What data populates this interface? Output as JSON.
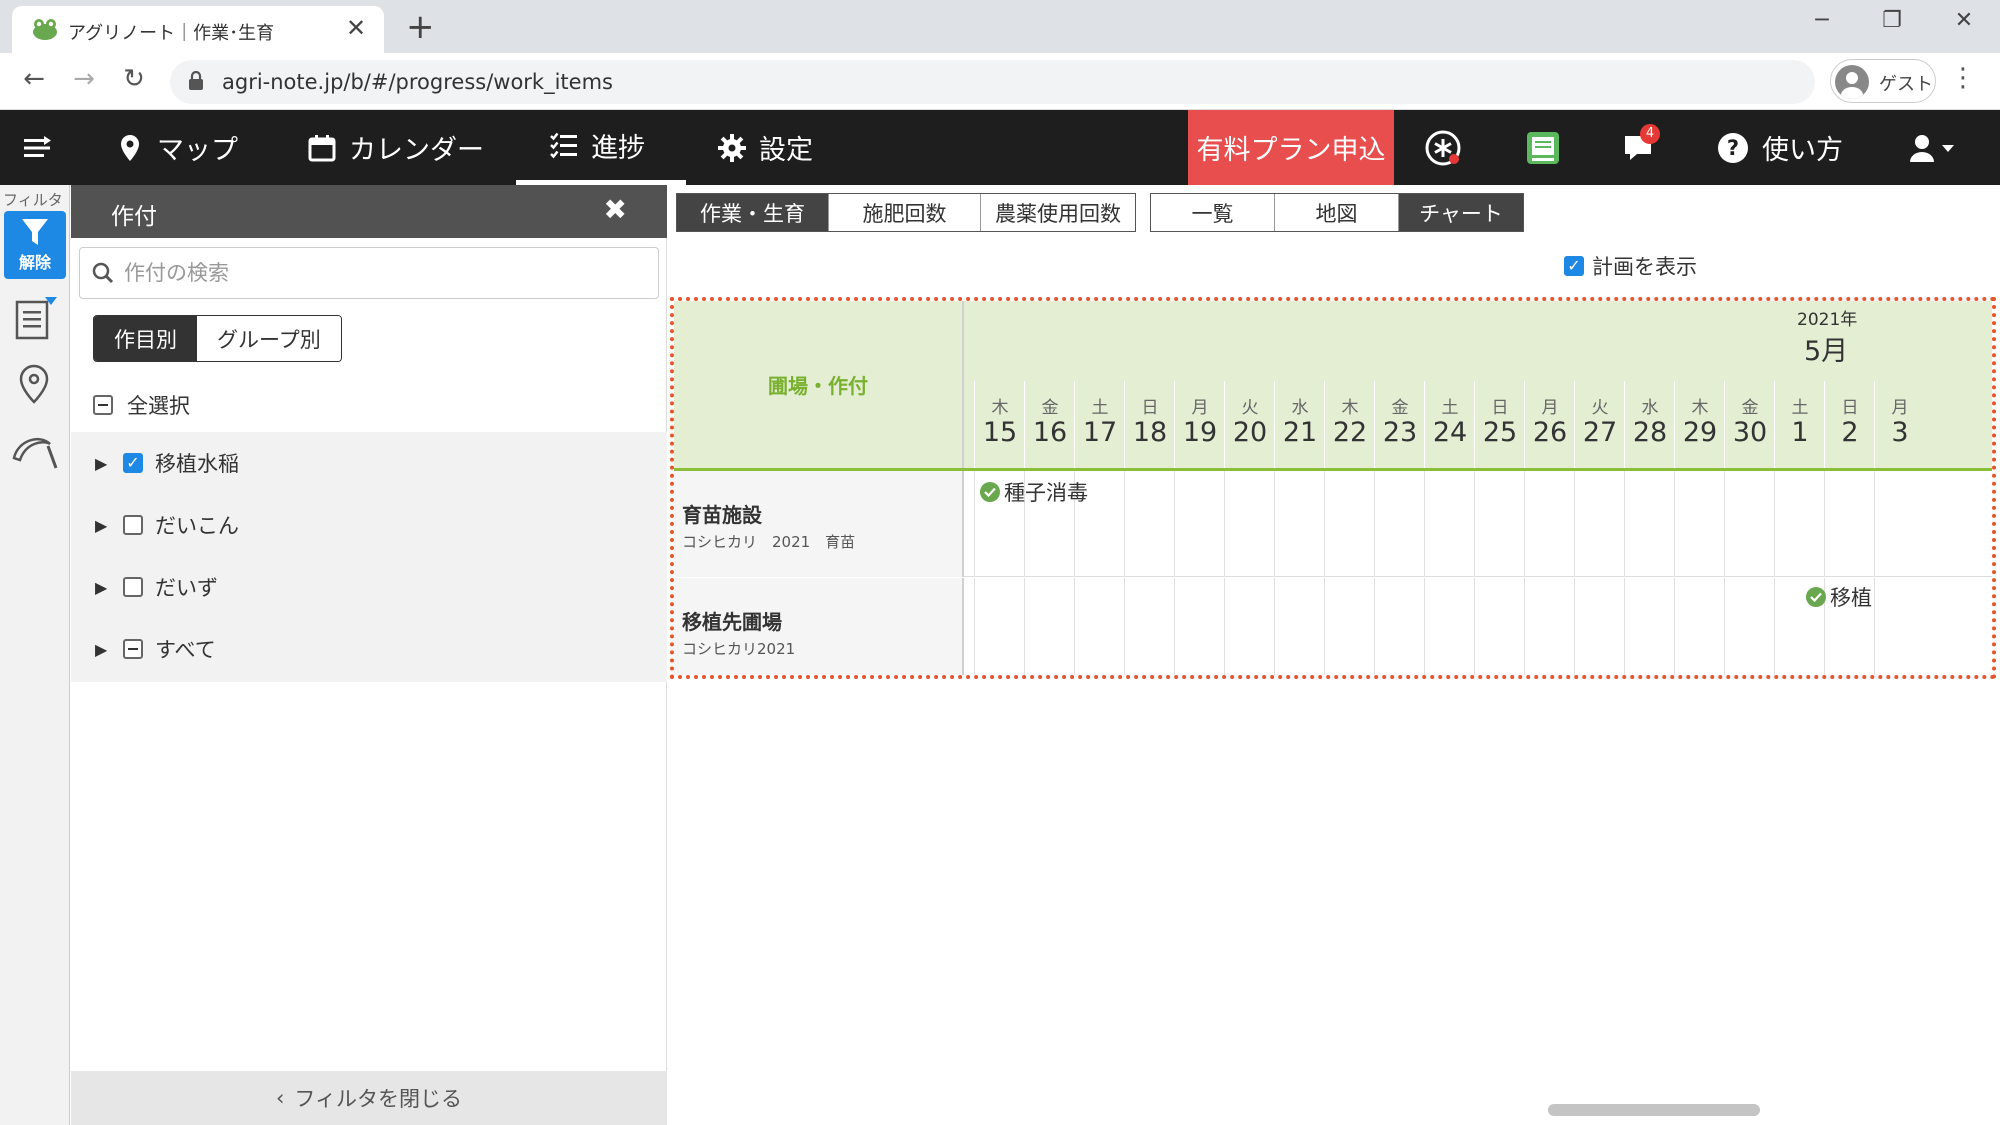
{
  "browser": {
    "tab_title": "アグリノート｜作業･生育",
    "url": "agri-note.jp/b/#/progress/work_items",
    "profile_label": "ゲスト"
  },
  "nav": {
    "map": "マップ",
    "calendar": "カレンダー",
    "progress": "進捗",
    "settings": "設定",
    "plan_button": "有料プラン申込",
    "notification_count": "4",
    "help": "使い方"
  },
  "rail": {
    "filter_label": "フィルタ",
    "filter_button": "解除"
  },
  "filter_panel": {
    "title": "作付",
    "search_placeholder": "作付の検索",
    "toggle_by_crop": "作目別",
    "toggle_by_group": "グループ別",
    "select_all": "全選択",
    "crops": [
      {
        "label": "移植水稲",
        "state": "checked"
      },
      {
        "label": "だいこん",
        "state": "unchecked"
      },
      {
        "label": "だいず",
        "state": "unchecked"
      },
      {
        "label": "すべて",
        "state": "partial"
      }
    ],
    "close_label": "フィルタを閉じる"
  },
  "main": {
    "tabs_left": [
      "作業・生育",
      "施肥回数",
      "農薬使用回数"
    ],
    "tabs_right": [
      "一覧",
      "地図",
      "チャート"
    ],
    "show_plan_label": "計画を表示",
    "show_plan_checked": true
  },
  "chart": {
    "header_label": "圃場・作付",
    "year": "2021年",
    "month": "5月",
    "days": [
      {
        "dow": "木",
        "num": "15"
      },
      {
        "dow": "金",
        "num": "16"
      },
      {
        "dow": "土",
        "num": "17"
      },
      {
        "dow": "日",
        "num": "18"
      },
      {
        "dow": "月",
        "num": "19"
      },
      {
        "dow": "火",
        "num": "20"
      },
      {
        "dow": "水",
        "num": "21"
      },
      {
        "dow": "木",
        "num": "22"
      },
      {
        "dow": "金",
        "num": "23"
      },
      {
        "dow": "土",
        "num": "24"
      },
      {
        "dow": "日",
        "num": "25"
      },
      {
        "dow": "月",
        "num": "26"
      },
      {
        "dow": "火",
        "num": "27"
      },
      {
        "dow": "水",
        "num": "28"
      },
      {
        "dow": "木",
        "num": "29"
      },
      {
        "dow": "金",
        "num": "30"
      },
      {
        "dow": "土",
        "num": "1"
      },
      {
        "dow": "日",
        "num": "2"
      },
      {
        "dow": "月",
        "num": "3"
      }
    ],
    "rows": [
      {
        "name": "育苗施設",
        "sub": "コシヒカリ　2021　育苗",
        "task": "種子消毒"
      },
      {
        "name": "移植先圃場",
        "sub": "コシヒカリ2021",
        "task": "移植"
      }
    ]
  },
  "colors": {
    "nav_bg": "#1e1e1e",
    "plan_button": "#e94e4e",
    "accent_blue": "#1e88e5",
    "chart_header_bg": "#e3eed2",
    "chart_header_text": "#7ab030",
    "highlight_border": "#e8542a"
  }
}
